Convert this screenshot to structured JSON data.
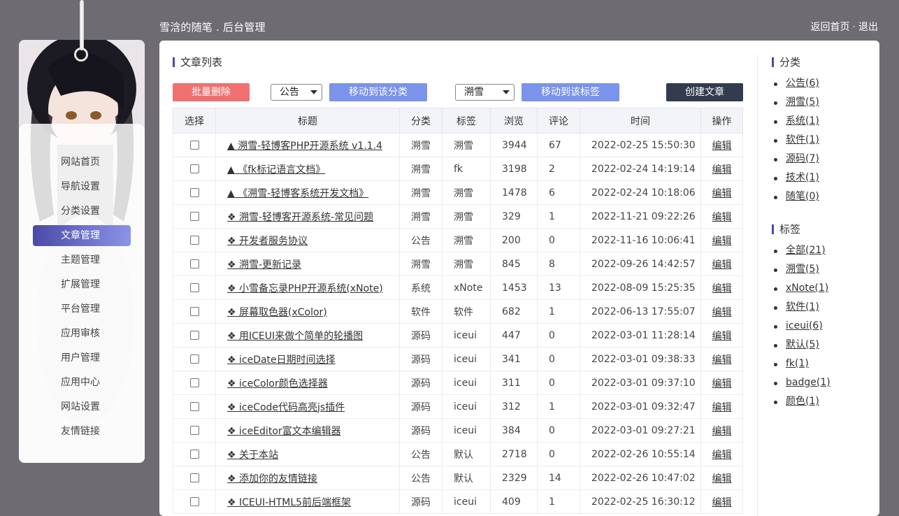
{
  "header": {
    "site_title": "雪浛的随笔 . 后台管理",
    "link_home": "返回首页",
    "separator": "·",
    "link_logout": "退出"
  },
  "sidebar": {
    "items": [
      {
        "label": "网站首页",
        "active": false
      },
      {
        "label": "导航设置",
        "active": false
      },
      {
        "label": "分类设置",
        "active": false
      },
      {
        "label": "文章管理",
        "active": true
      },
      {
        "label": "主题管理",
        "active": false
      },
      {
        "label": "扩展管理",
        "active": false
      },
      {
        "label": "平台管理",
        "active": false
      },
      {
        "label": "应用审核",
        "active": false
      },
      {
        "label": "用户管理",
        "active": false
      },
      {
        "label": "应用中心",
        "active": false
      },
      {
        "label": "网站设置",
        "active": false
      },
      {
        "label": "友情链接",
        "active": false
      }
    ]
  },
  "main": {
    "section_title": "文章列表",
    "toolbar": {
      "batch_delete": "批量删除",
      "category_select": "公告",
      "move_to_category": "移动到该分类",
      "tag_select": "溯雪",
      "move_to_tag": "移动到该标签",
      "create_article": "创建文章"
    },
    "table": {
      "headers": [
        "选择",
        "标题",
        "分类",
        "标签",
        "浏览",
        "评论",
        "时间",
        "操作"
      ],
      "edit_label": "编辑",
      "rows": [
        {
          "title": "▲ 溯雪-轻博客PHP开源系统 v1.1.4",
          "category": "溯雪",
          "tag": "溯雪",
          "views": "3944",
          "comments": "67",
          "time": "2022-02-25 15:50:30"
        },
        {
          "title": "▲ 《fk标记语言文档》",
          "category": "溯雪",
          "tag": "fk",
          "views": "3198",
          "comments": "2",
          "time": "2022-02-24 14:19:14"
        },
        {
          "title": "▲ 《溯雪-轻博客系统开发文档》",
          "category": "溯雪",
          "tag": "溯雪",
          "views": "1478",
          "comments": "6",
          "time": "2022-02-24 10:18:06"
        },
        {
          "title": "❖ 溯雪-轻博客开源系统-常见问题",
          "category": "溯雪",
          "tag": "溯雪",
          "views": "329",
          "comments": "1",
          "time": "2022-11-21 09:22:26"
        },
        {
          "title": "❖ 开发者服务协议",
          "category": "公告",
          "tag": "溯雪",
          "views": "200",
          "comments": "0",
          "time": "2022-11-16 10:06:41"
        },
        {
          "title": "❖ 溯雪-更新记录",
          "category": "溯雪",
          "tag": "溯雪",
          "views": "845",
          "comments": "8",
          "time": "2022-09-26 14:42:57"
        },
        {
          "title": "❖ 小雪备忘录PHP开源系统(xNote)",
          "category": "系统",
          "tag": "xNote",
          "views": "1453",
          "comments": "13",
          "time": "2022-08-09 15:25:35"
        },
        {
          "title": "❖ 屏幕取色器(xColor)",
          "category": "软件",
          "tag": "软件",
          "views": "682",
          "comments": "1",
          "time": "2022-06-13 17:55:07"
        },
        {
          "title": "❖ 用ICEUI来做个简单的轮播图",
          "category": "源码",
          "tag": "iceui",
          "views": "447",
          "comments": "0",
          "time": "2022-03-01 11:28:14"
        },
        {
          "title": "❖ iceDate日期时间选择",
          "category": "源码",
          "tag": "iceui",
          "views": "341",
          "comments": "0",
          "time": "2022-03-01 09:38:33"
        },
        {
          "title": "❖ iceColor颜色选择器",
          "category": "源码",
          "tag": "iceui",
          "views": "311",
          "comments": "0",
          "time": "2022-03-01 09:37:10"
        },
        {
          "title": "❖ iceCode代码高亮js插件",
          "category": "源码",
          "tag": "iceui",
          "views": "312",
          "comments": "1",
          "time": "2022-03-01 09:32:47"
        },
        {
          "title": "❖ iceEditor富文本编辑器",
          "category": "源码",
          "tag": "iceui",
          "views": "384",
          "comments": "0",
          "time": "2022-03-01 09:27:21"
        },
        {
          "title": "❖ 关于本站",
          "category": "公告",
          "tag": "默认",
          "views": "2718",
          "comments": "0",
          "time": "2022-02-26 10:55:14"
        },
        {
          "title": "❖ 添加你的友情链接",
          "category": "公告",
          "tag": "默认",
          "views": "2329",
          "comments": "14",
          "time": "2022-02-26 10:47:02"
        },
        {
          "title": "❖ ICEUI-HTML5前后端框架",
          "category": "源码",
          "tag": "iceui",
          "views": "409",
          "comments": "1",
          "time": "2022-02-25 16:30:12"
        }
      ]
    }
  },
  "right": {
    "categories_title": "分类",
    "categories": [
      "公告(6)",
      "溯雪(5)",
      "系统(1)",
      "软件(1)",
      "源码(7)",
      "技术(1)",
      "随笔(0)"
    ],
    "tags_title": "标签",
    "tags": [
      "全部(21)",
      "溯雪(5)",
      "xNote(1)",
      "软件(1)",
      "iceui(6)",
      "默认(5)",
      "fk(1)",
      "badge(1)",
      "颜色(1)"
    ]
  },
  "colors": {
    "background": "#6f6b72",
    "active_nav_start": "#4a4aa6",
    "active_nav_end": "#8b94e6",
    "delete_button": "#f07070",
    "move_button": "#7b93ea",
    "create_button": "#323c4e"
  }
}
